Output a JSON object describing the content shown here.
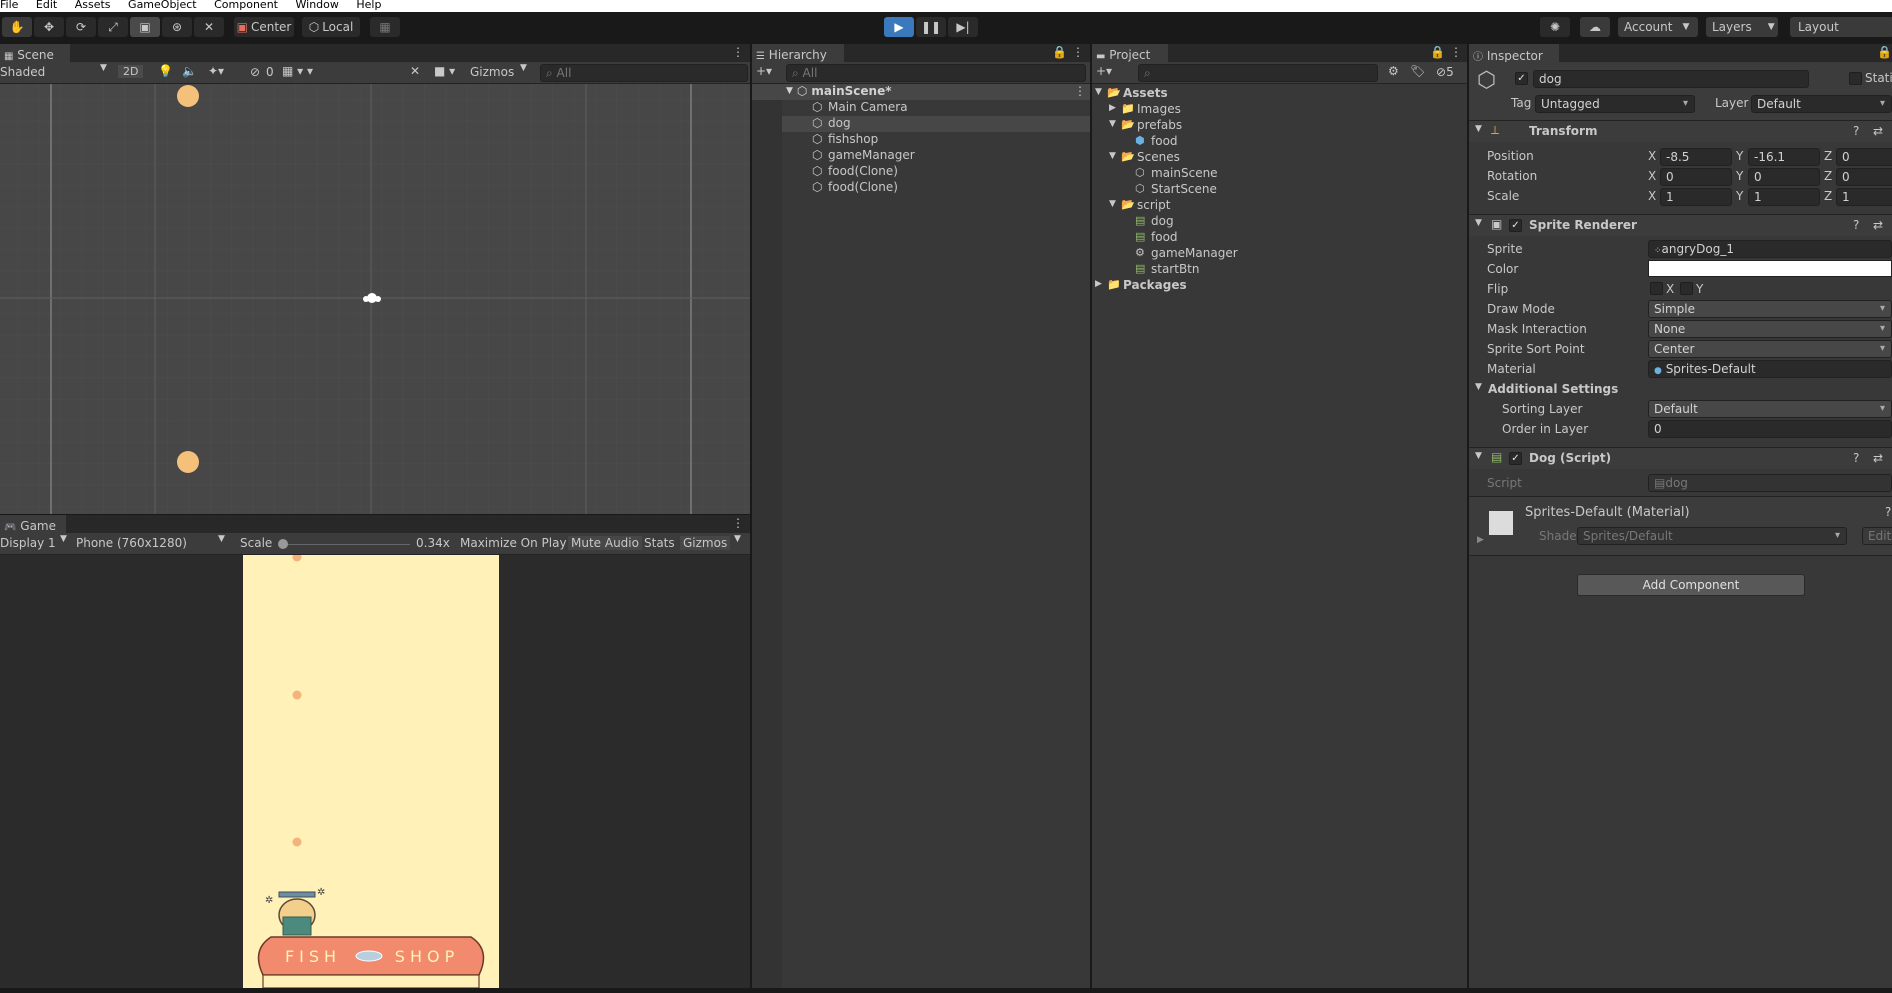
{
  "menu": [
    "File",
    "Edit",
    "Assets",
    "GameObject",
    "Component",
    "Window",
    "Help"
  ],
  "toolbar": {
    "pivot": "Center",
    "space": "Local",
    "account": "Account",
    "layers": "Layers",
    "layout": "Layout"
  },
  "scene": {
    "tab": "Scene",
    "shading": "Shaded",
    "mode2d": "2D",
    "hidden_count": "0",
    "gizmos": "Gizmos",
    "search_placeholder": "All"
  },
  "game": {
    "tab": "Game",
    "display": "Display 1",
    "resolution": "Phone (760x1280)",
    "scale_label": "Scale",
    "scale_value": "0.34x",
    "scale_fraction": 0.02,
    "maximize": "Maximize On Play",
    "mute": "Mute Audio",
    "stats": "Stats",
    "gizmos": "Gizmos",
    "sign_left": "FISH",
    "sign_right": "SHOP"
  },
  "hierarchy": {
    "tab": "Hierarchy",
    "search_placeholder": "All",
    "scene": "mainScene*",
    "items": [
      "Main Camera",
      "dog",
      "fishshop",
      "gameManager",
      "food(Clone)",
      "food(Clone)"
    ],
    "selected": "dog"
  },
  "project": {
    "tab": "Project",
    "hidden_count": "5",
    "tree": [
      {
        "label": "Assets",
        "bold": true,
        "type": "folder-open"
      },
      {
        "label": "Images",
        "type": "folder"
      },
      {
        "label": "prefabs",
        "type": "folder-open"
      },
      {
        "label": "food",
        "type": "prefab"
      },
      {
        "label": "Scenes",
        "type": "folder-open"
      },
      {
        "label": "mainScene",
        "type": "scene"
      },
      {
        "label": "StartScene",
        "type": "scene"
      },
      {
        "label": "script",
        "type": "folder-open"
      },
      {
        "label": "dog",
        "type": "script"
      },
      {
        "label": "food",
        "type": "script"
      },
      {
        "label": "gameManager",
        "type": "gear"
      },
      {
        "label": "startBtn",
        "type": "script"
      },
      {
        "label": "Packages",
        "bold": true,
        "type": "folder"
      }
    ]
  },
  "inspector": {
    "tab": "Inspector",
    "object_name": "dog",
    "static_label": "Static",
    "tag_label": "Tag",
    "tag": "Untagged",
    "layer_label": "Layer",
    "layer": "Default",
    "transform": {
      "title": "Transform",
      "position_label": "Position",
      "rotation_label": "Rotation",
      "scale_label": "Scale",
      "position": {
        "x": "-8.5",
        "y": "-16.1",
        "z": "0"
      },
      "rotation": {
        "x": "0",
        "y": "0",
        "z": "0"
      },
      "scale": {
        "x": "1",
        "y": "1",
        "z": "1"
      }
    },
    "sprite_renderer": {
      "title": "Sprite Renderer",
      "sprite_label": "Sprite",
      "sprite": "angryDog_1",
      "color_label": "Color",
      "flip_label": "Flip",
      "flip_x": "X",
      "flip_y": "Y",
      "draw_mode_label": "Draw Mode",
      "draw_mode": "Simple",
      "mask_label": "Mask Interaction",
      "mask": "None",
      "sort_point_label": "Sprite Sort Point",
      "sort_point": "Center",
      "material_label": "Material",
      "material": "Sprites-Default",
      "additional_label": "Additional Settings",
      "sorting_layer_label": "Sorting Layer",
      "sorting_layer": "Default",
      "order_label": "Order in Layer",
      "order": "0"
    },
    "dog_script": {
      "title": "Dog (Script)",
      "script_label": "Script",
      "script": "dog"
    },
    "material_block": {
      "title": "Sprites-Default (Material)",
      "shader_label": "Shader",
      "shader": "Sprites/Default",
      "edit": "Edit..."
    },
    "add_component": "Add Component"
  },
  "colors": {
    "accent": "#3a79bb",
    "game_bg": "#fff1b8",
    "food": "#f5c07a",
    "shop": "#f28b6d"
  }
}
